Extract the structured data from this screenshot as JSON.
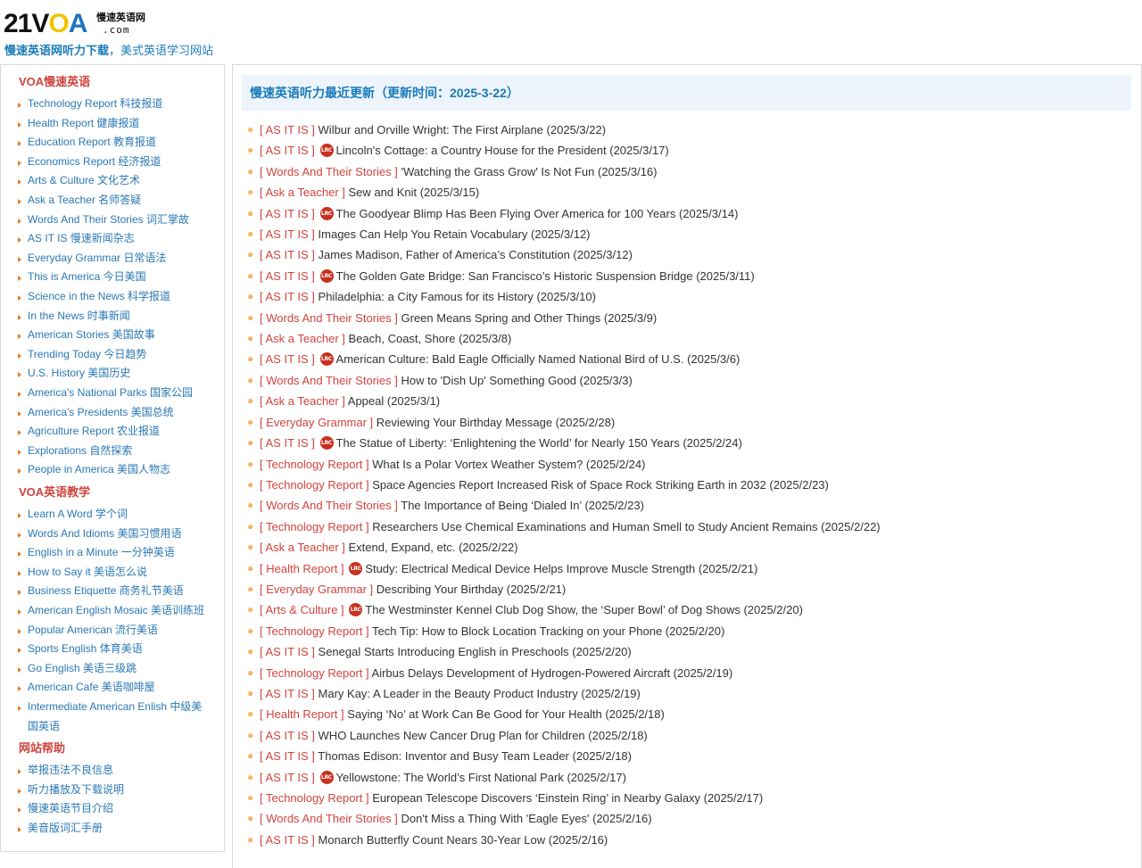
{
  "logo": {
    "num": "21",
    "v": "V",
    "o": "O",
    "a": "A",
    "cn": "慢速英语网",
    "com": ".com"
  },
  "slogan": {
    "strong": "慢速英语网听力下载",
    "rest": "，美式英语学习网站"
  },
  "sidebar": {
    "section1": {
      "heading": "VOA慢速英语",
      "items": [
        "Technology Report 科技报道",
        "Health Report 健康报道",
        "Education Report 教育报道",
        "Economics Report 经济报道",
        "Arts & Culture 文化艺术",
        "Ask a Teacher 名师答疑",
        "Words And Their Stories 词汇掌故",
        "AS IT IS 慢速新闻杂志",
        "Everyday Grammar 日常语法",
        "This is America 今日美国",
        "Science in the News 科学报道",
        "In the News 时事新闻",
        "American Stories 美国故事",
        "Trending Today 今日趋势",
        "U.S. History 美国历史",
        "America's National Parks 国家公园",
        "America's Presidents 美国总统",
        "Agriculture Report 农业报道",
        "Explorations 自然探索",
        "People in America 美国人物志"
      ]
    },
    "section2": {
      "heading": "VOA英语教学",
      "items": [
        "Learn A Word 学个词",
        "Words And Idioms 美国习惯用语",
        "English in a Minute 一分钟英语",
        "How to Say it 美语怎么说",
        "Business Etiquette 商务礼节美语",
        "American English Mosaic 美语训练班",
        "Popular American 流行美语",
        "Sports English 体育美语",
        "Go English 美语三级跳",
        "American Cafe 美语咖啡屋",
        "Intermediate American Enlish 中级美国英语"
      ]
    },
    "section3": {
      "heading": "网站帮助",
      "items": [
        "举报违法不良信息",
        "听力播放及下载说明",
        "慢速英语节目介绍",
        "美音版词汇手册"
      ]
    }
  },
  "main": {
    "title": "慢速英语听力最近更新（更新时间：2025-3-22）",
    "lrc_label": "LRC",
    "news": [
      {
        "cat": "[ AS IT IS ]",
        "lrc": false,
        "title": "Wilbur and Orville Wright: The First Airplane (2025/3/22)"
      },
      {
        "cat": "[ AS IT IS ]",
        "lrc": true,
        "title": "Lincoln's Cottage: a Country House for the President (2025/3/17)"
      },
      {
        "cat": "[ Words And Their Stories ]",
        "lrc": false,
        "title": "'Watching the Grass Grow' Is Not Fun (2025/3/16)"
      },
      {
        "cat": "[ Ask a Teacher ]",
        "lrc": false,
        "title": "Sew and Knit (2025/3/15)"
      },
      {
        "cat": "[ AS IT IS ]",
        "lrc": true,
        "title": "The Goodyear Blimp Has Been Flying Over America for 100 Years (2025/3/14)"
      },
      {
        "cat": "[ AS IT IS ]",
        "lrc": false,
        "title": "Images Can Help You Retain Vocabulary (2025/3/12)"
      },
      {
        "cat": "[ AS IT IS ]",
        "lrc": false,
        "title": "James Madison, Father of America’s Constitution (2025/3/12)"
      },
      {
        "cat": "[ AS IT IS ]",
        "lrc": true,
        "title": "The Golden Gate Bridge: San Francisco’s Historic Suspension Bridge (2025/3/11)"
      },
      {
        "cat": "[ AS IT IS ]",
        "lrc": false,
        "title": "Philadelphia: a City Famous for its History (2025/3/10)"
      },
      {
        "cat": "[ Words And Their Stories ]",
        "lrc": false,
        "title": "Green Means Spring and Other Things (2025/3/9)"
      },
      {
        "cat": "[ Ask a Teacher ]",
        "lrc": false,
        "title": "Beach, Coast, Shore (2025/3/8)"
      },
      {
        "cat": "[ AS IT IS ]",
        "lrc": true,
        "title": "American Culture: Bald Eagle Officially Named National Bird of U.S. (2025/3/6)"
      },
      {
        "cat": "[ Words And Their Stories ]",
        "lrc": false,
        "title": "How to 'Dish Up' Something Good (2025/3/3)"
      },
      {
        "cat": "[ Ask a Teacher ]",
        "lrc": false,
        "title": "Appeal (2025/3/1)"
      },
      {
        "cat": "[ Everyday Grammar ]",
        "lrc": false,
        "title": "Reviewing Your Birthday Message (2025/2/28)"
      },
      {
        "cat": "[ AS IT IS ]",
        "lrc": true,
        "title": "The Statue of Liberty: ‘Enlightening the World’ for Nearly 150 Years (2025/2/24)"
      },
      {
        "cat": "[ Technology Report ]",
        "lrc": false,
        "title": "What Is a Polar Vortex Weather System? (2025/2/24)"
      },
      {
        "cat": "[ Technology Report ]",
        "lrc": false,
        "title": "Space Agencies Report Increased Risk of Space Rock Striking Earth in 2032 (2025/2/23)"
      },
      {
        "cat": "[ Words And Their Stories ]",
        "lrc": false,
        "title": "The Importance of Being ‘Dialed In’ (2025/2/23)"
      },
      {
        "cat": "[ Technology Report ]",
        "lrc": false,
        "title": "Researchers Use Chemical Examinations and Human Smell to Study Ancient Remains (2025/2/22)"
      },
      {
        "cat": "[ Ask a Teacher ]",
        "lrc": false,
        "title": "Extend, Expand, etc. (2025/2/22)"
      },
      {
        "cat": "[ Health Report ]",
        "lrc": true,
        "title": "Study: Electrical Medical Device Helps Improve Muscle Strength (2025/2/21)"
      },
      {
        "cat": "[ Everyday Grammar ]",
        "lrc": false,
        "title": "Describing Your Birthday (2025/2/21)"
      },
      {
        "cat": "[ Arts & Culture ]",
        "lrc": true,
        "title": "The Westminster Kennel Club Dog Show, the ‘Super Bowl’ of Dog Shows (2025/2/20)"
      },
      {
        "cat": "[ Technology Report ]",
        "lrc": false,
        "title": "Tech Tip: How to Block Location Tracking on your Phone (2025/2/20)"
      },
      {
        "cat": "[ AS IT IS ]",
        "lrc": false,
        "title": "Senegal Starts Introducing English in Preschools (2025/2/20)"
      },
      {
        "cat": "[ Technology Report ]",
        "lrc": false,
        "title": "Airbus Delays Development of Hydrogen-Powered Aircraft (2025/2/19)"
      },
      {
        "cat": "[ AS IT IS ]",
        "lrc": false,
        "title": "Mary Kay: A Leader in the Beauty Product Industry (2025/2/19)"
      },
      {
        "cat": "[ Health Report ]",
        "lrc": false,
        "title": "Saying ‘No’ at Work Can Be Good for Your Health (2025/2/18)"
      },
      {
        "cat": "[ AS IT IS ]",
        "lrc": false,
        "title": "WHO Launches New Cancer Drug Plan for Children (2025/2/18)"
      },
      {
        "cat": "[ AS IT IS ]",
        "lrc": false,
        "title": "Thomas Edison: Inventor and Busy Team Leader (2025/2/18)"
      },
      {
        "cat": "[ AS IT IS ]",
        "lrc": true,
        "title": "Yellowstone: The World’s First National Park (2025/2/17)"
      },
      {
        "cat": "[ Technology Report ]",
        "lrc": false,
        "title": "European Telescope Discovers ‘Einstein Ring’ in Nearby Galaxy (2025/2/17)"
      },
      {
        "cat": "[ Words And Their Stories ]",
        "lrc": false,
        "title": "Don't Miss a Thing With 'Eagle Eyes' (2025/2/16)"
      },
      {
        "cat": "[ AS IT IS ]",
        "lrc": false,
        "title": "Monarch Butterfly Count Nears 30-Year Low (2025/2/16)"
      }
    ]
  }
}
